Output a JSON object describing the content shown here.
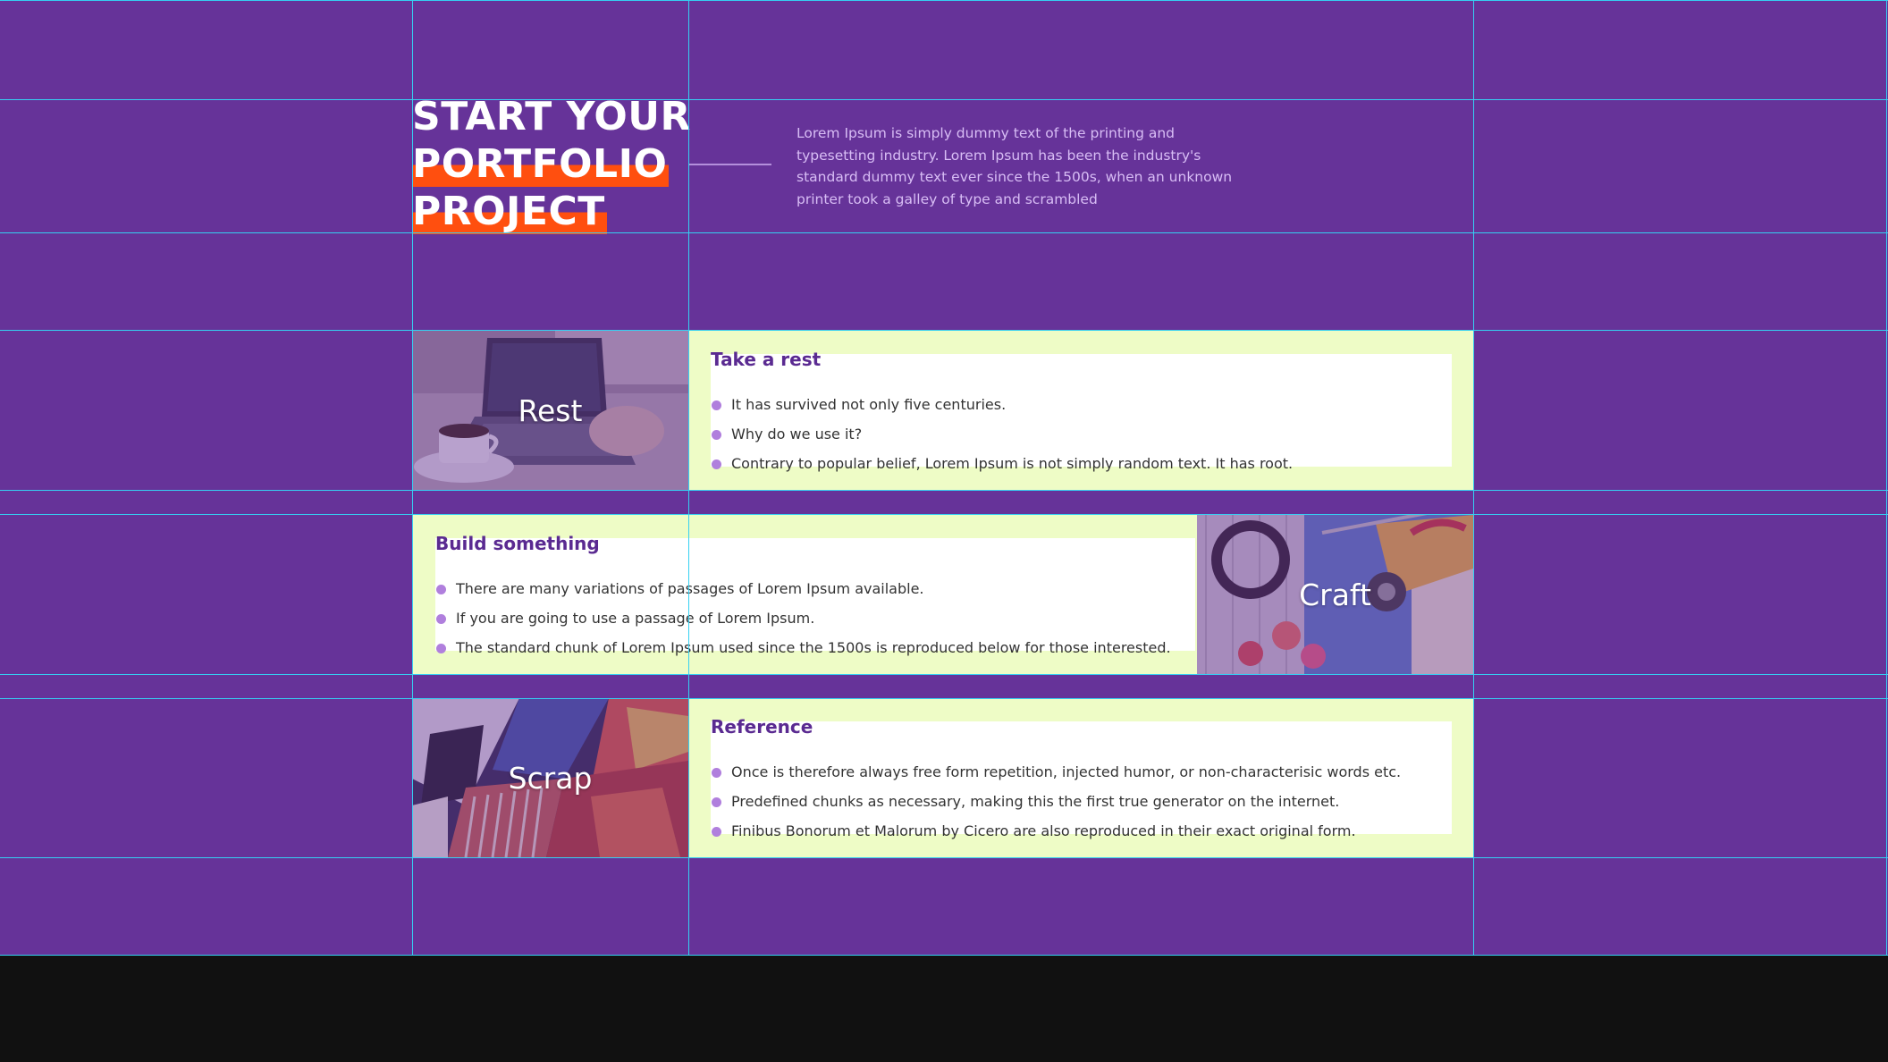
{
  "hero": {
    "title_line1": "START YOUR",
    "title_line2": "PORTFOLIO",
    "title_line3": "PROJECT",
    "description": "Lorem Ipsum is simply dummy text of the printing and typesetting industry. Lorem Ipsum has been the industry's standard dummy text ever since the 1500s, when an unknown printer took a galley of type and scrambled"
  },
  "colors": {
    "background": "#663399",
    "highlight": "#ff4f0f",
    "card_background": "#eefcc6",
    "card_title": "#5a2a91",
    "bullet": "#b07fdd",
    "grid_line": "#35d0f2"
  },
  "cards": [
    {
      "image_label": "Rest",
      "image_icon": "laptop-coffee-photo-icon",
      "title": "Take a rest",
      "bullets": [
        "It has survived not only five centuries.",
        "Why do we use it?",
        "Contrary to popular belief, Lorem Ipsum is not simply random text. It has root."
      ]
    },
    {
      "image_label": "Craft",
      "image_icon": "craft-tools-photo-icon",
      "title": "Build something",
      "bullets": [
        "There are many variations of passages of Lorem Ipsum available.",
        "If you are going to use a passage of Lorem Ipsum.",
        "The standard chunk of Lorem Ipsum used since the 1500s is reproduced below for those interested."
      ]
    },
    {
      "image_label": "Scrap",
      "image_icon": "scrapbook-collage-photo-icon",
      "title": "Reference",
      "bullets": [
        "Once is therefore always free form repetition, injected humor, or non-characterisic words etc.",
        "Predefined chunks as necessary, making this the first true generator on the internet.",
        "Finibus Bonorum et Malorum by Cicero are also reproduced in their exact original form."
      ]
    }
  ]
}
